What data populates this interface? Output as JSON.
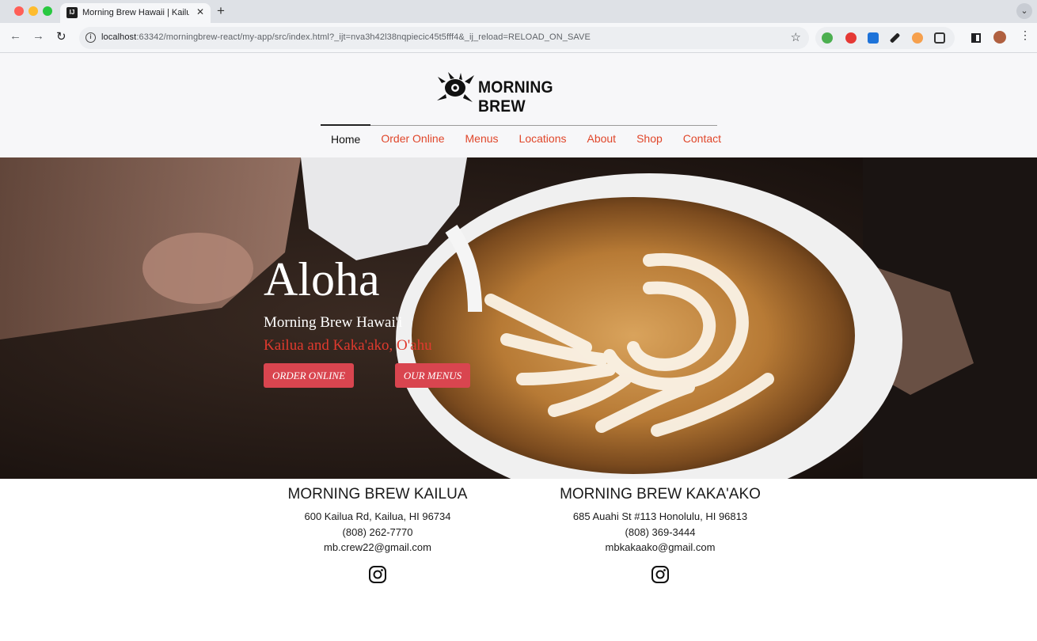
{
  "browser": {
    "tab_title": "Morning Brew Hawaii | Kailua",
    "tab_favicon_text": "IJ",
    "url_host": "localhost",
    "url_rest": ":63342/morningbrew-react/my-app/src/index.html?_ijt=nva3h42l38nqpiecic45t5fff4&_ij_reload=RELOAD_ON_SAVE"
  },
  "header": {
    "logo_text": "MORNING BREW",
    "nav": [
      {
        "label": "Home",
        "active": true
      },
      {
        "label": "Order Online"
      },
      {
        "label": "Menus"
      },
      {
        "label": "Locations"
      },
      {
        "label": "About"
      },
      {
        "label": "Shop"
      },
      {
        "label": "Contact"
      }
    ]
  },
  "hero": {
    "title": "Aloha",
    "subtitle": "Morning Brew Hawai'i",
    "locations_line": "Kailua and Kaka'ako, O'ahu",
    "order_button": "ORDER ONLINE",
    "menus_button": "OUR MENUS"
  },
  "locations": [
    {
      "name": "MORNING BREW KAILUA",
      "address": "600 Kailua Rd, Kailua, HI 96734",
      "phone": "(808) 262-7770",
      "email": "mb.crew22@gmail.com"
    },
    {
      "name": "MORNING BREW KAKA'AKO",
      "address": "685 Auahi St #113 Honolulu, HI 96813",
      "phone": "(808) 369-3444",
      "email": "mbkakaako@gmail.com"
    }
  ],
  "colors": {
    "accent": "#e0462a",
    "button": "#d9454f",
    "hero_location": "#e03a2e"
  },
  "icons": [
    "back-icon",
    "forward-icon",
    "reload-icon",
    "info-icon",
    "star-icon",
    "instagram-icon"
  ]
}
